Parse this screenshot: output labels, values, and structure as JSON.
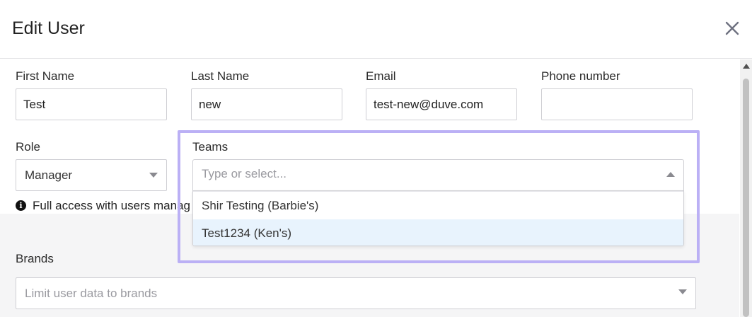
{
  "dialog": {
    "title": "Edit User"
  },
  "form": {
    "first_name": {
      "label": "First Name",
      "value": "Test"
    },
    "last_name": {
      "label": "Last Name",
      "value": "new"
    },
    "email": {
      "label": "Email",
      "value": "test-new@duve.com"
    },
    "phone": {
      "label": "Phone number",
      "value": ""
    },
    "role": {
      "label": "Role",
      "value": "Manager"
    },
    "role_info": "Full access with users manag",
    "teams": {
      "label": "Teams",
      "placeholder": "Type or select...",
      "options": [
        {
          "label": "Shir Testing (Barbie's)",
          "active": false
        },
        {
          "label": "Test1234 (Ken's)",
          "active": true
        }
      ]
    },
    "brands": {
      "label": "Brands",
      "placeholder": "Limit user data to brands"
    }
  },
  "icons": {
    "close": "close-icon",
    "info": "info-icon",
    "caret": "chevron-down-icon"
  },
  "colors": {
    "highlight": "#bbb0f5",
    "active_option": "#e8f3fd",
    "grey_band": "#f5f5f6"
  }
}
